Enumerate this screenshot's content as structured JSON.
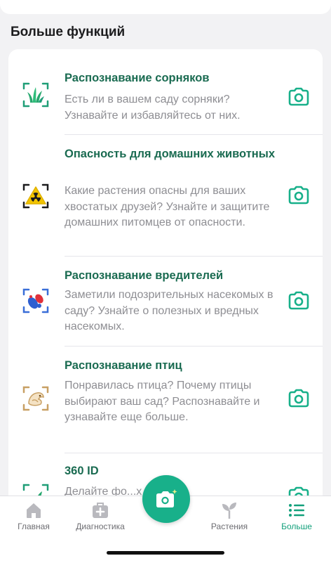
{
  "section": {
    "title": "Больше функций"
  },
  "features": [
    {
      "title": "Распознавание сорняков",
      "desc": "Есть ли в вашем саду сорняки? Узнавайте и избавляйтесь от них.",
      "icon": "weed-icon"
    },
    {
      "title": "Опасность для домашних животных",
      "desc": "Какие растения опасны для ваших хвостатых друзей? Узнайте и защитите домашних питомцев от опасности.",
      "icon": "pet-hazard-icon"
    },
    {
      "title": "Распознавание вредителей",
      "desc": "Заметили подозрительных насекомых в саду? Узнайте о полезных и вредных насекомых.",
      "icon": "pest-icon"
    },
    {
      "title": "Распознавание птиц",
      "desc": "Понравилась птица? Почему птицы выбирают ваш сад? Распознавайте и узнавайте еще больше.",
      "icon": "bird-icon"
    },
    {
      "title": "360 ID",
      "desc": "Делайте фо...х углов и",
      "icon": "360-icon"
    }
  ],
  "tabbar": {
    "tabs": [
      {
        "label": "Главная",
        "icon": "home-icon"
      },
      {
        "label": "Диагностика",
        "icon": "medical-kit-icon"
      },
      {
        "label": "Растения",
        "icon": "sprout-icon"
      },
      {
        "label": "Больше",
        "icon": "list-icon"
      }
    ],
    "active": "Больше"
  },
  "colors": {
    "accent": "#18b08a",
    "title_green": "#1a6b51",
    "text_gray": "#8e8e93",
    "background": "#f2f2f4"
  }
}
